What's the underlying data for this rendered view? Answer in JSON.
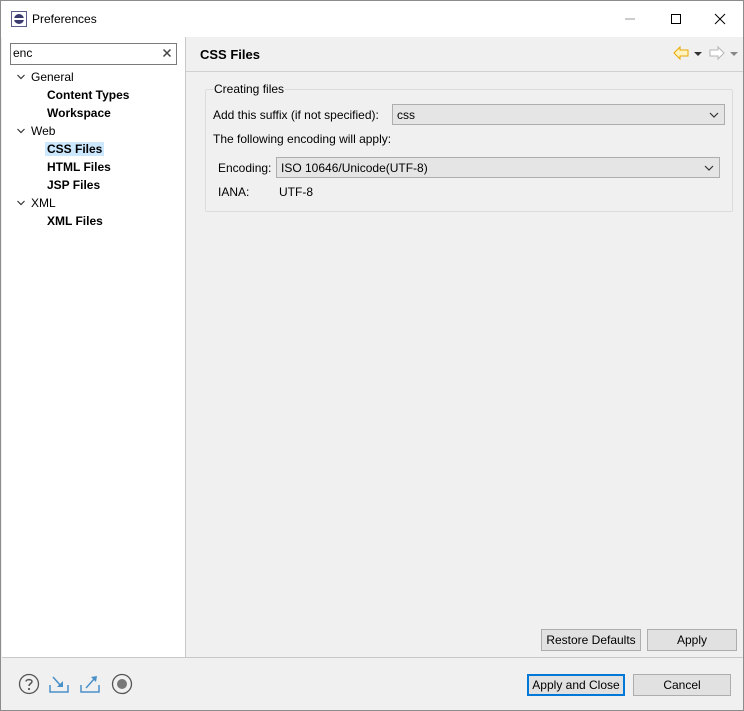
{
  "window": {
    "title": "Preferences",
    "minimize_icon": "minimize-icon",
    "maximize_icon": "maximize-icon",
    "close_icon": "close-icon"
  },
  "filter": {
    "value": "enc",
    "clear_icon": "clear-x-icon"
  },
  "tree": {
    "general": "General",
    "content_types": "Content Types",
    "workspace": "Workspace",
    "web": "Web",
    "css_files": "CSS Files",
    "html_files": "HTML Files",
    "jsp_files": "JSP Files",
    "xml": "XML",
    "xml_files": "XML Files",
    "selected": "CSS Files"
  },
  "page": {
    "title": "CSS Files",
    "group_title": "Creating files",
    "suffix_label": "Add this suffix (if not specified):",
    "suffix_value": "css",
    "encoding_note": "The following encoding will apply:",
    "encoding_label": "Encoding:",
    "encoding_value": "ISO 10646/Unicode(UTF-8)",
    "iana_label": "IANA:",
    "iana_value": "UTF-8"
  },
  "buttons": {
    "restore_defaults": "Restore Defaults",
    "apply": "Apply",
    "apply_and_close": "Apply and Close",
    "cancel": "Cancel"
  },
  "colors": {
    "selection": "#cce8ff",
    "default_button_border": "#0078d7",
    "back_arrow": "#e8a800"
  }
}
